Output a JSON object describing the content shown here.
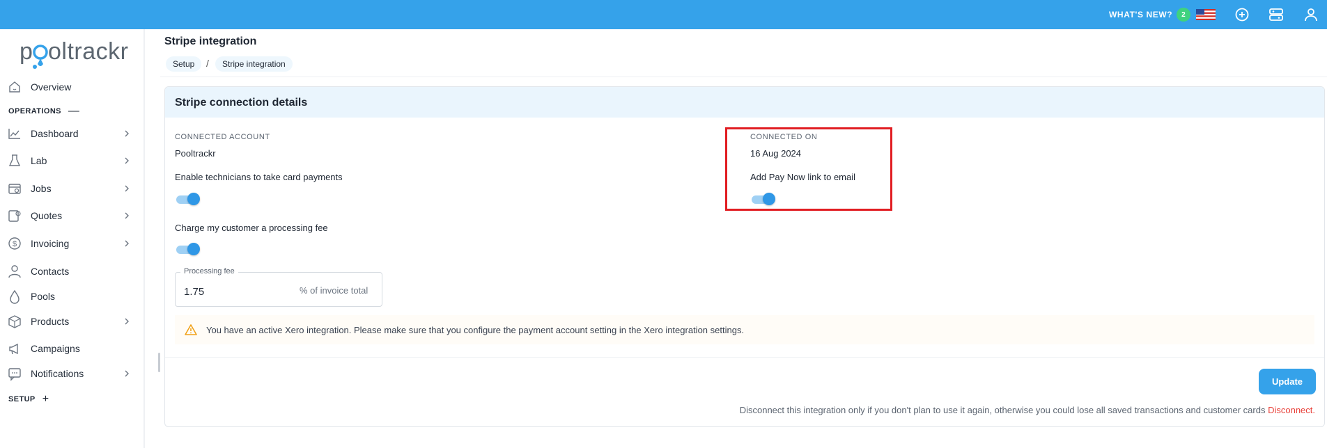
{
  "topbar": {
    "whats_new_label": "WHAT'S NEW?",
    "whats_new_count": "2",
    "icons": [
      "us-flag-icon",
      "plus-circle-icon",
      "settings-panel-icon",
      "user-icon"
    ]
  },
  "sidebar": {
    "logo_text": "pooltrackr",
    "overview": "Overview",
    "operations_label": "OPERATIONS",
    "operations_symbol": "—",
    "items": [
      {
        "label": "Dashboard",
        "icon": "chart-icon",
        "has_chevron": true
      },
      {
        "label": "Lab",
        "icon": "flask-icon",
        "has_chevron": true
      },
      {
        "label": "Jobs",
        "icon": "jobs-icon",
        "has_chevron": true
      },
      {
        "label": "Quotes",
        "icon": "quote-icon",
        "has_chevron": true
      },
      {
        "label": "Invoicing",
        "icon": "dollar-icon",
        "has_chevron": true
      },
      {
        "label": "Contacts",
        "icon": "person-icon",
        "has_chevron": false
      },
      {
        "label": "Pools",
        "icon": "drop-icon",
        "has_chevron": false
      },
      {
        "label": "Products",
        "icon": "box-icon",
        "has_chevron": true
      },
      {
        "label": "Campaigns",
        "icon": "megaphone-icon",
        "has_chevron": false
      },
      {
        "label": "Notifications",
        "icon": "message-icon",
        "has_chevron": true
      }
    ],
    "setup_label": "SETUP",
    "setup_symbol": "+"
  },
  "header": {
    "title": "Stripe integration",
    "breadcrumb": [
      "Setup",
      "Stripe integration"
    ],
    "breadcrumb_separator": "/"
  },
  "card": {
    "title": "Stripe connection details",
    "connected_account_label": "CONNECTED ACCOUNT",
    "connected_account_value": "Pooltrackr",
    "connected_on_label": "CONNECTED ON",
    "connected_on_value": "16 Aug 2024",
    "enable_card_payments_label": "Enable technicians to take card payments",
    "enable_card_payments_on": true,
    "pay_now_link_label": "Add Pay Now link to email",
    "pay_now_link_on": true,
    "processing_fee_toggle_label": "Charge my customer a processing fee",
    "processing_fee_on": true,
    "processing_fee_field_label": "Processing fee",
    "processing_fee_value": "1.75",
    "processing_fee_suffix": "% of invoice total",
    "warning_text": "You have an active Xero integration. Please make sure that you configure the payment account setting in the Xero integration settings.",
    "update_button": "Update",
    "disconnect_note": "Disconnect this integration only if you don't plan to use it again, otherwise you could lose all saved transactions and customer cards",
    "disconnect_link": "Disconnect."
  },
  "colors": {
    "topbar": "#35a2ea",
    "accent": "#2f97e6",
    "highlight_box": "#e11d22",
    "danger_link": "#e8413a",
    "card_header": "#eaf5fd"
  }
}
